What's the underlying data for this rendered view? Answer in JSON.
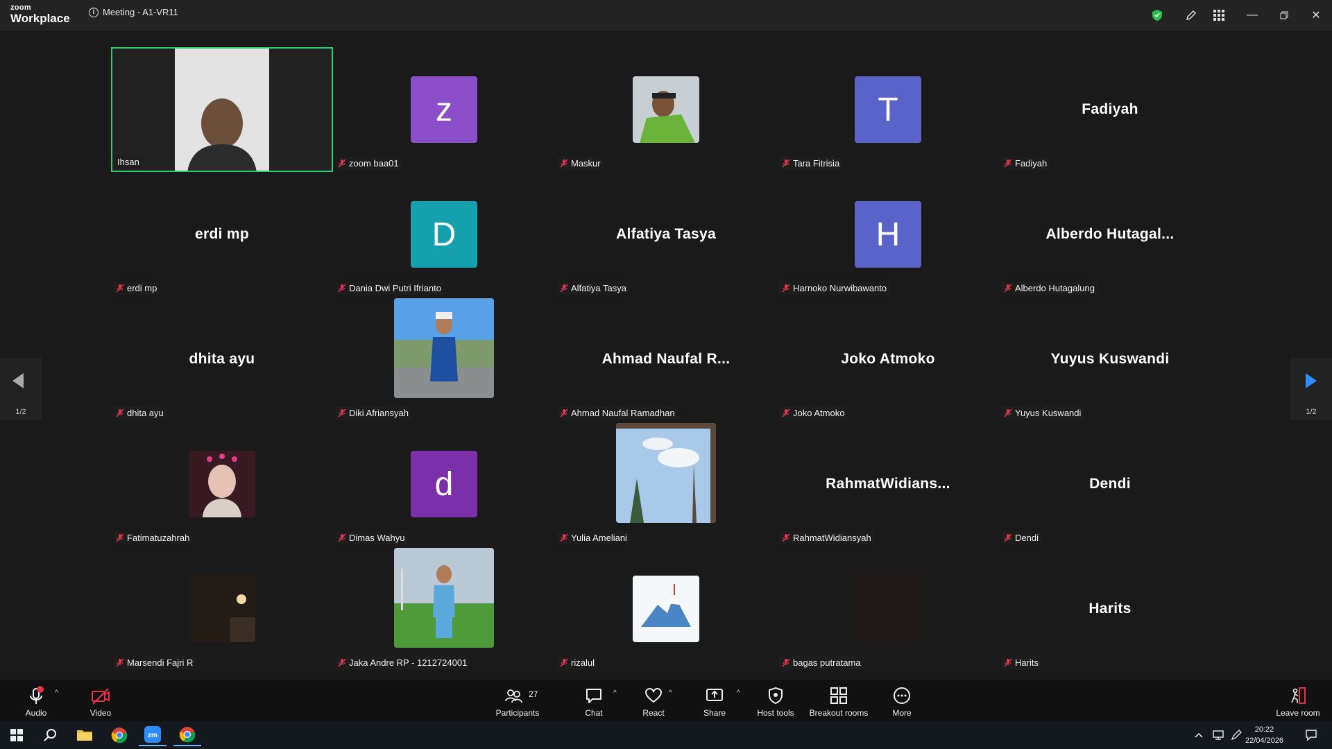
{
  "app": {
    "logo_line1": "zoom",
    "logo_line2": "Workplace",
    "meeting_title": "Meeting - A1-VR11"
  },
  "pager": {
    "left_label": "1/2",
    "right_label": "1/2"
  },
  "tiles": [
    {
      "chip": "Ihsan",
      "display": "video"
    },
    {
      "chip": "zoom baa01",
      "avatar_letter": "z",
      "avatar_color": "#8a4fc9"
    },
    {
      "chip": "Maskur",
      "display": "photo"
    },
    {
      "chip": "Tara Fitrisia",
      "avatar_letter": "T",
      "avatar_color": "#5a63c8"
    },
    {
      "chip": "Fadiyah",
      "big_name": "Fadiyah"
    },
    {
      "chip": "erdi mp",
      "big_name": "erdi mp"
    },
    {
      "chip": "Dania Dwi Putri Ifrianto",
      "avatar_letter": "D",
      "avatar_color": "#14a1ad"
    },
    {
      "chip": "Alfatiya Tasya",
      "big_name": "Alfatiya Tasya"
    },
    {
      "chip": "Harnoko Nurwibawanto",
      "avatar_letter": "H",
      "avatar_color": "#5a63c8"
    },
    {
      "chip": "Alberdo Hutagalung",
      "big_name": "Alberdo Hutagal..."
    },
    {
      "chip": "dhita ayu",
      "big_name": "dhita ayu"
    },
    {
      "chip": "Diki Afriansyah",
      "display": "photo"
    },
    {
      "chip": "Ahmad Naufal Ramadhan",
      "big_name": "Ahmad Naufal R..."
    },
    {
      "chip": "Joko Atmoko",
      "big_name": "Joko Atmoko"
    },
    {
      "chip": "Yuyus Kuswandi",
      "big_name": "Yuyus Kuswandi"
    },
    {
      "chip": "Fatimatuzahrah",
      "display": "photo"
    },
    {
      "chip": "Dimas Wahyu",
      "avatar_letter": "d",
      "avatar_color": "#7b2fa8"
    },
    {
      "chip": "Yulia Ameliani",
      "display": "photo"
    },
    {
      "chip": "RahmatWidiansyah",
      "big_name": "RahmatWidians..."
    },
    {
      "chip": "Dendi",
      "big_name": "Dendi"
    },
    {
      "chip": "Marsendi Fajri R",
      "display": "photo"
    },
    {
      "chip": "Jaka Andre RP - 1212724001",
      "display": "photo"
    },
    {
      "chip": "rizalul",
      "display": "photo"
    },
    {
      "chip": "bagas putratama",
      "display": "photo"
    },
    {
      "chip": "Harits",
      "big_name": "Harits"
    }
  ],
  "toolbar": {
    "audio": "Audio",
    "video": "Video",
    "participants": "Participants",
    "participants_count": "27",
    "chat": "Chat",
    "react": "React",
    "share": "Share",
    "host_tools": "Host tools",
    "breakout": "Breakout rooms",
    "more": "More",
    "leave": "Leave room"
  },
  "taskbar": {
    "time": "20:22",
    "date": "22/04/2026"
  },
  "colors": {
    "active_border": "#2ecc71",
    "mute_red": "#e0344a",
    "pager_arrow": "#2d8cff"
  }
}
